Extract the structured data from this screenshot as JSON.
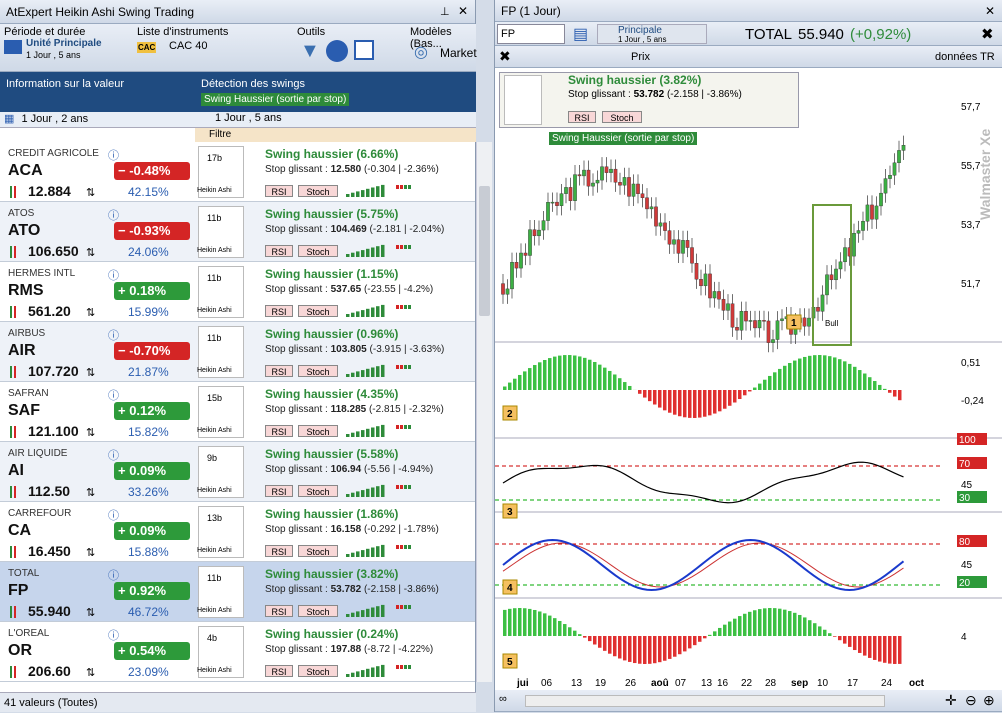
{
  "left": {
    "title": "AtExpert Heikin Ashi Swing Trading",
    "period_label": "Période et durée",
    "unit_label": "Unité Principale",
    "unit_sub": "1 Jour , 5 ans",
    "list_label": "Liste d'instruments",
    "list_value": "CAC 40",
    "outils": "Outils",
    "models": "Modèles (Bas...",
    "market": "Market",
    "col1": "Information sur la valeur",
    "col2": "Détection des swings",
    "swing_tag": "Swing Haussier (sortie par stop)",
    "filter1": "1 Jour , 2 ans",
    "filter2": "1 Jour , 5 ans",
    "filtre": "Filtre",
    "status": "41 valeurs (Toutes)",
    "rows": [
      {
        "name": "CREDIT AGRICOLE",
        "tk": "ACA",
        "chg": "−  -0.48%",
        "dir": "dn",
        "price": "12.884",
        "vol": "42.15%",
        "mini": "17b",
        "swing": "Swing haussier (6.66%)",
        "stop": "Stop glissant : ",
        "sv": "12.580",
        "sd": " (-0.304 | -2.36%)"
      },
      {
        "name": "ATOS",
        "tk": "ATO",
        "chg": "−  -0.93%",
        "dir": "dn",
        "price": "106.650",
        "vol": "24.06%",
        "mini": "11b",
        "swing": "Swing haussier (5.75%)",
        "stop": "Stop glissant : ",
        "sv": "104.469",
        "sd": " (-2.181 | -2.04%)"
      },
      {
        "name": "HERMES INTL",
        "tk": "RMS",
        "chg": "+  0.18%",
        "dir": "up",
        "price": "561.20",
        "vol": "15.99%",
        "mini": "11b",
        "swing": "Swing haussier (1.15%)",
        "stop": "Stop glissant : ",
        "sv": "537.65",
        "sd": " (-23.55 | -4.2%)"
      },
      {
        "name": "AIRBUS",
        "tk": "AIR",
        "chg": "−  -0.70%",
        "dir": "dn",
        "price": "107.720",
        "vol": "21.87%",
        "mini": "11b",
        "swing": "Swing haussier (0.96%)",
        "stop": "Stop glissant : ",
        "sv": "103.805",
        "sd": " (-3.915 | -3.63%)"
      },
      {
        "name": "SAFRAN",
        "tk": "SAF",
        "chg": "+  0.12%",
        "dir": "up",
        "price": "121.100",
        "vol": "15.82%",
        "mini": "15b",
        "swing": "Swing haussier (4.35%)",
        "stop": "Stop glissant : ",
        "sv": "118.285",
        "sd": " (-2.815 | -2.32%)"
      },
      {
        "name": "AIR LIQUIDE",
        "tk": "AI",
        "chg": "+  0.09%",
        "dir": "up",
        "price": "112.50",
        "vol": "33.26%",
        "mini": "9b",
        "swing": "Swing haussier (5.58%)",
        "stop": "Stop glissant : ",
        "sv": "106.94",
        "sd": " (-5.56 | -4.94%)"
      },
      {
        "name": "CARREFOUR",
        "tk": "CA",
        "chg": "+  0.09%",
        "dir": "up",
        "price": "16.450",
        "vol": "15.88%",
        "mini": "13b",
        "swing": "Swing haussier (1.86%)",
        "stop": "Stop glissant : ",
        "sv": "16.158",
        "sd": " (-0.292 | -1.78%)"
      },
      {
        "name": "TOTAL",
        "tk": "FP",
        "chg": "+  0.92%",
        "dir": "up",
        "price": "55.940",
        "vol": "46.72%",
        "mini": "11b",
        "swing": "Swing haussier (3.82%)",
        "stop": "Stop glissant : ",
        "sv": "53.782",
        "sd": " (-2.158 | -3.86%)"
      },
      {
        "name": "L'OREAL",
        "tk": "OR",
        "chg": "+  0.54%",
        "dir": "up",
        "price": "206.60",
        "vol": "23.09%",
        "mini": "4b",
        "swing": "Swing haussier (0.24%)",
        "stop": "Stop glissant : ",
        "sv": "197.88",
        "sd": " (-8.72 | -4.22%)"
      }
    ],
    "heikin": "Heikin Ashi",
    "rsi": "RSI",
    "stoch": "Stoch"
  },
  "right": {
    "title": "FP (1 Jour)",
    "sym": "FP",
    "model": "Principale",
    "model_sub": "1 Jour , 5 ans",
    "quote_name": "TOTAL",
    "quote_price": "55.940",
    "quote_chg": "(+0,92%)",
    "prix": "Prix",
    "tr": "données TR",
    "card_swing": "Swing haussier (3.82%)",
    "card_stop": "Stop glissant : ",
    "card_sv": "53.782",
    "card_sd": " (-2.158 | -3.86%)",
    "card_tag": "Swing Haussier (sortie par stop)",
    "yticks": [
      "57,7",
      "55,7",
      "53,7",
      "51,7"
    ],
    "y2": [
      "0,51",
      "-0,24"
    ],
    "y3": [
      "100",
      "70",
      "45",
      "30"
    ],
    "y4": [
      "80",
      "45",
      "20"
    ],
    "y5": [
      "4"
    ],
    "xticks": [
      "jui",
      "06",
      "13",
      "19",
      "26",
      "aoû",
      "07",
      "13",
      "16",
      "22",
      "28",
      "sep",
      "10",
      "17",
      "24",
      "oct"
    ],
    "watermark": "Walmaster Xe",
    "bull": "Bull",
    "labels": [
      "1",
      "2",
      "3",
      "4",
      "5"
    ]
  }
}
